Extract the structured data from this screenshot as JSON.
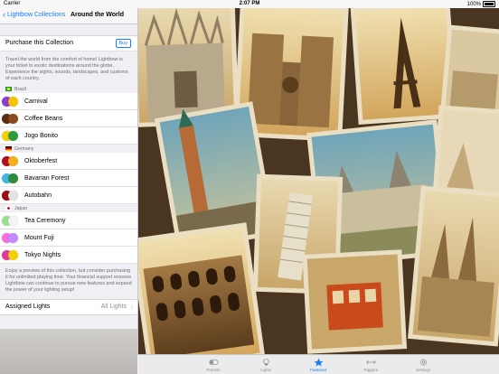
{
  "status_bar": {
    "carrier": "Carrier",
    "time": "2:07 PM",
    "battery": "100%"
  },
  "nav": {
    "back_label": "Lightbow Collections",
    "title": "Around the World"
  },
  "purchase": {
    "label": "Purchase this Collection",
    "buy_label": "Buy"
  },
  "description": "Travel the world from the comfort of home! Lightbow is your ticket to exotic destinations around the globe. Experience the sights, sounds, landscapes, and customs of each country.",
  "sections": [
    {
      "country": "Brazil",
      "flag_colors": [
        "#009c3b",
        "#ffdf00"
      ],
      "items": [
        {
          "name": "Carnival",
          "swatches": [
            "#8a3ec9",
            "#f5c400"
          ]
        },
        {
          "name": "Coffee Beans",
          "swatches": [
            "#5a2d12",
            "#8b4a1c"
          ]
        },
        {
          "name": "Jogo Bonito",
          "swatches": [
            "#f1d100",
            "#2f9a3a"
          ]
        }
      ]
    },
    {
      "country": "Germany",
      "flag_colors": [
        "#000000",
        "#dd0000",
        "#ffce00"
      ],
      "items": [
        {
          "name": "Oktoberfest",
          "swatches": [
            "#b0111c",
            "#f2b01d"
          ]
        },
        {
          "name": "Bavarian Forest",
          "swatches": [
            "#3fb8e6",
            "#2e8b3c"
          ]
        },
        {
          "name": "Autobahn",
          "swatches": [
            "#9b0d14",
            "#e4e4e4"
          ]
        }
      ]
    },
    {
      "country": "Japan",
      "flag_colors": [
        "#ffffff",
        "#bc002d"
      ],
      "items": [
        {
          "name": "Tea Ceremony",
          "swatches": [
            "#9be08f",
            "#f4f4f4"
          ]
        },
        {
          "name": "Mount Fuji",
          "swatches": [
            "#f46fe0",
            "#c28bff"
          ]
        },
        {
          "name": "Tokyo Nights",
          "swatches": [
            "#e4379b",
            "#f1d200"
          ]
        }
      ]
    }
  ],
  "footer_text": "Enjoy a preview of this collection, but consider purchasing it for unlimited playing time. Your financial support ensures Lightbow can continue to pursue new features and expand the power of your lighting setup!",
  "assigned": {
    "label": "Assigned Lights",
    "value": "All Lights"
  },
  "tabs": [
    {
      "label": "Presets",
      "icon": "toggle-icon",
      "active": false
    },
    {
      "label": "Lights",
      "icon": "lightbulb-icon",
      "active": false
    },
    {
      "label": "Featured",
      "icon": "star-icon",
      "active": true
    },
    {
      "label": "Triggers",
      "icon": "arrows-icon",
      "active": false
    },
    {
      "label": "Settings",
      "icon": "gear-icon",
      "active": false
    }
  ],
  "colors": {
    "accent": "#157efb"
  }
}
